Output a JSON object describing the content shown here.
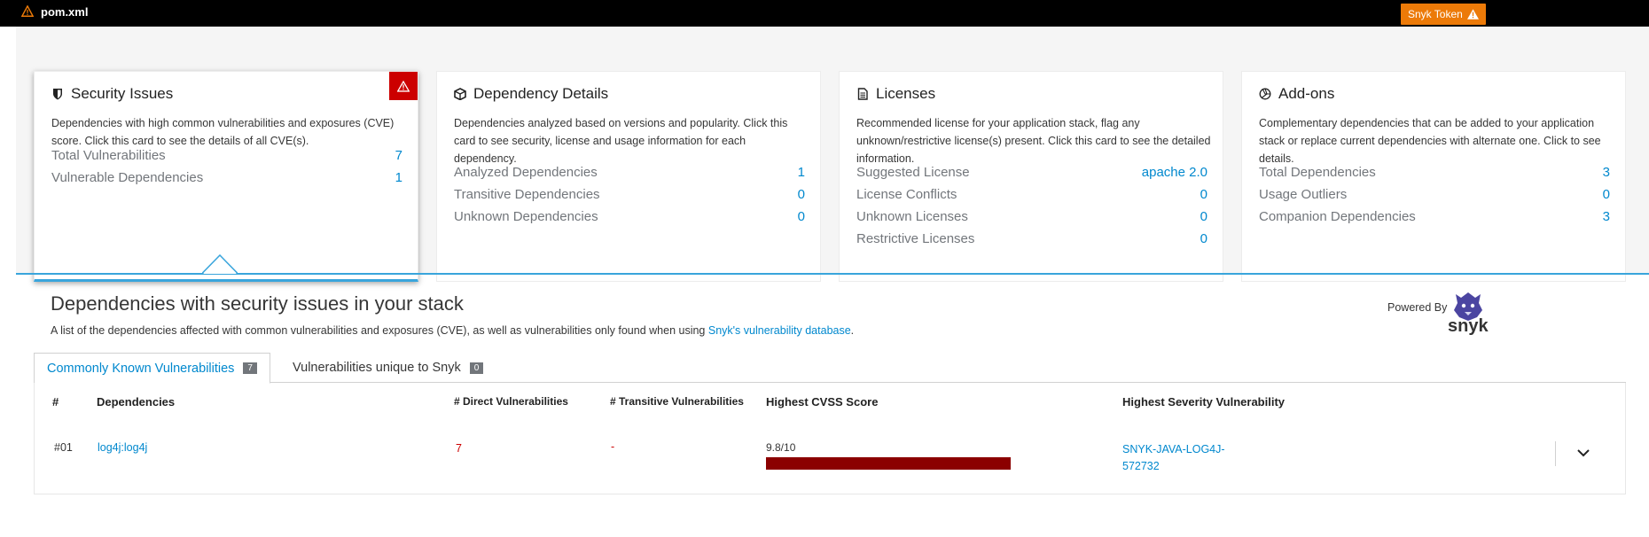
{
  "header": {
    "file_name": "pom.xml",
    "snyk_token_label": "Snyk Token",
    "colors": {
      "bar": "#000000",
      "snyk_button": "#ec7a08"
    }
  },
  "cards": [
    {
      "title": "Security Issues",
      "icon": "shield-icon",
      "description": "Dependencies with high common vulnerabilities and exposures (CVE) score. Click this card to see the details of all CVE(s).",
      "rows": [
        {
          "label": "Total Vulnerabilities",
          "value": "7"
        },
        {
          "label": "Vulnerable Dependencies",
          "value": "1"
        }
      ]
    },
    {
      "title": "Dependency Details",
      "icon": "cube-icon",
      "description": "Dependencies analyzed based on versions and popularity. Click this card to see security, license and usage information for each dependency.",
      "rows": [
        {
          "label": "Analyzed Dependencies",
          "value": "1"
        },
        {
          "label": "Transitive Dependencies",
          "value": "0"
        },
        {
          "label": "Unknown Dependencies",
          "value": "0"
        }
      ]
    },
    {
      "title": "Licenses",
      "icon": "document-icon",
      "description": "Recommended license for your application stack, flag any unknown/restrictive license(s) present. Click this card to see the detailed information.",
      "rows": [
        {
          "label": "Suggested License",
          "value": "apache 2.0"
        },
        {
          "label": "License Conflicts",
          "value": "0"
        },
        {
          "label": "Unknown Licenses",
          "value": "0"
        },
        {
          "label": "Restrictive Licenses",
          "value": "0"
        }
      ]
    },
    {
      "title": "Add-ons",
      "icon": "cubes-icon",
      "description": "Complementary dependencies that can be added to your application stack or replace current dependencies with alternate one. Click to see details.",
      "rows": [
        {
          "label": "Total Dependencies",
          "value": "3"
        },
        {
          "label": "Usage Outliers",
          "value": "0"
        },
        {
          "label": "Companion Dependencies",
          "value": "3"
        }
      ]
    }
  ],
  "section": {
    "title": "Dependencies with security issues in your stack",
    "subtitle_prefix": "A list of the dependencies affected with common vulnerabilities and exposures (CVE), as well as vulnerabilities only found when using ",
    "subtitle_link": "Snyk's vulnerability database",
    "subtitle_suffix": ".",
    "powered_by": "Powered By",
    "snyk_word": "snyk"
  },
  "tabs": [
    {
      "label": "Commonly Known Vulnerabilities",
      "count": "7"
    },
    {
      "label": "Vulnerabilities unique to Snyk",
      "count": "0"
    }
  ],
  "table": {
    "headers": [
      "#",
      "Dependencies",
      "# Direct Vulnerabilities",
      "# Transitive Vulnerabilities",
      "Highest CVSS Score",
      "Highest Severity Vulnerability"
    ],
    "rows": [
      {
        "index": "#01",
        "dependency": "log4j:log4j",
        "direct": "7",
        "transitive": "-",
        "cvss": "9.8/10",
        "cvss_fraction": 0.98,
        "vuln_line1": "SNYK-JAVA-LOG4J-",
        "vuln_line2": "572732"
      }
    ]
  }
}
